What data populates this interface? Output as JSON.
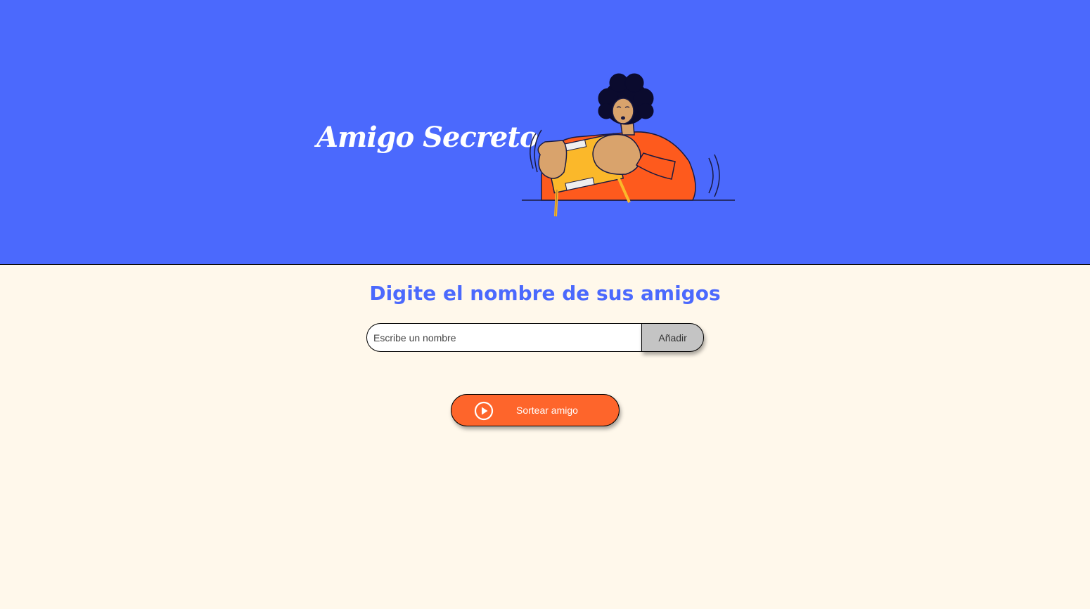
{
  "header": {
    "title": "Amigo Secreto",
    "illustration": "person-opening-gift-illustration"
  },
  "main": {
    "section_title": "Digite el nombre de sus amigos",
    "input": {
      "placeholder": "Escribe un nombre",
      "value": ""
    },
    "add_button_label": "Añadir",
    "draw_button": {
      "label": "Sortear amigo",
      "icon": "play-circle-icon"
    }
  },
  "colors": {
    "header_background": "#4B69FD",
    "page_background": "#FFF8EB",
    "accent": "#FE652B",
    "add_button": "#C4C4C4",
    "title_text": "#4B69FD"
  }
}
